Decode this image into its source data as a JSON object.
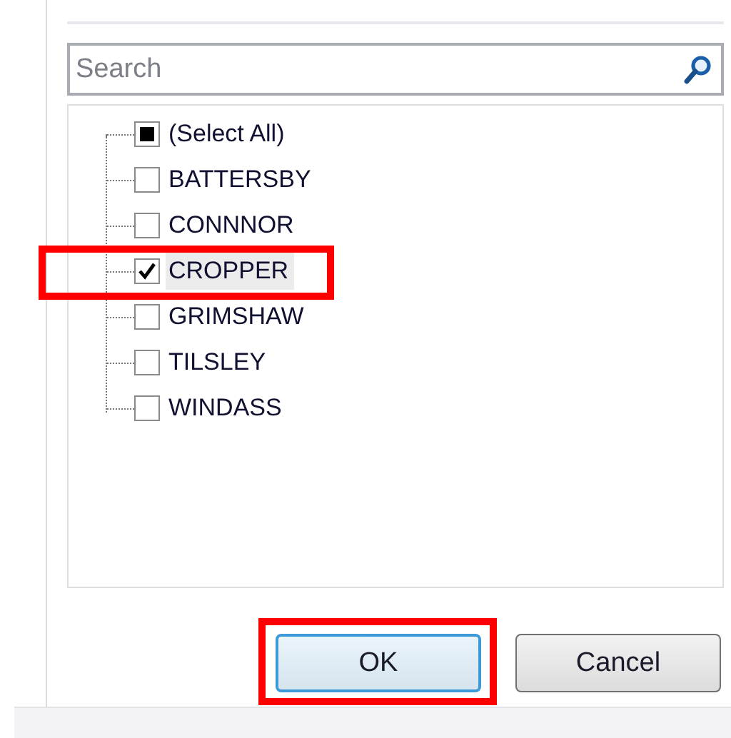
{
  "search": {
    "placeholder": "Search"
  },
  "items": [
    {
      "label": "(Select All)",
      "checked": false,
      "mixed": true,
      "selected": false,
      "highlighted": false
    },
    {
      "label": "BATTERSBY",
      "checked": false,
      "mixed": false,
      "selected": false,
      "highlighted": false
    },
    {
      "label": "CONNNOR",
      "checked": false,
      "mixed": false,
      "selected": false,
      "highlighted": false
    },
    {
      "label": "CROPPER",
      "checked": true,
      "mixed": false,
      "selected": true,
      "highlighted": true
    },
    {
      "label": "GRIMSHAW",
      "checked": false,
      "mixed": false,
      "selected": false,
      "highlighted": false
    },
    {
      "label": "TILSLEY",
      "checked": false,
      "mixed": false,
      "selected": false,
      "highlighted": false
    },
    {
      "label": "WINDASS",
      "checked": false,
      "mixed": false,
      "selected": false,
      "highlighted": false
    }
  ],
  "buttons": [
    {
      "label": "OK",
      "default": true,
      "highlighted": true
    },
    {
      "label": "Cancel",
      "default": false,
      "highlighted": false
    }
  ]
}
